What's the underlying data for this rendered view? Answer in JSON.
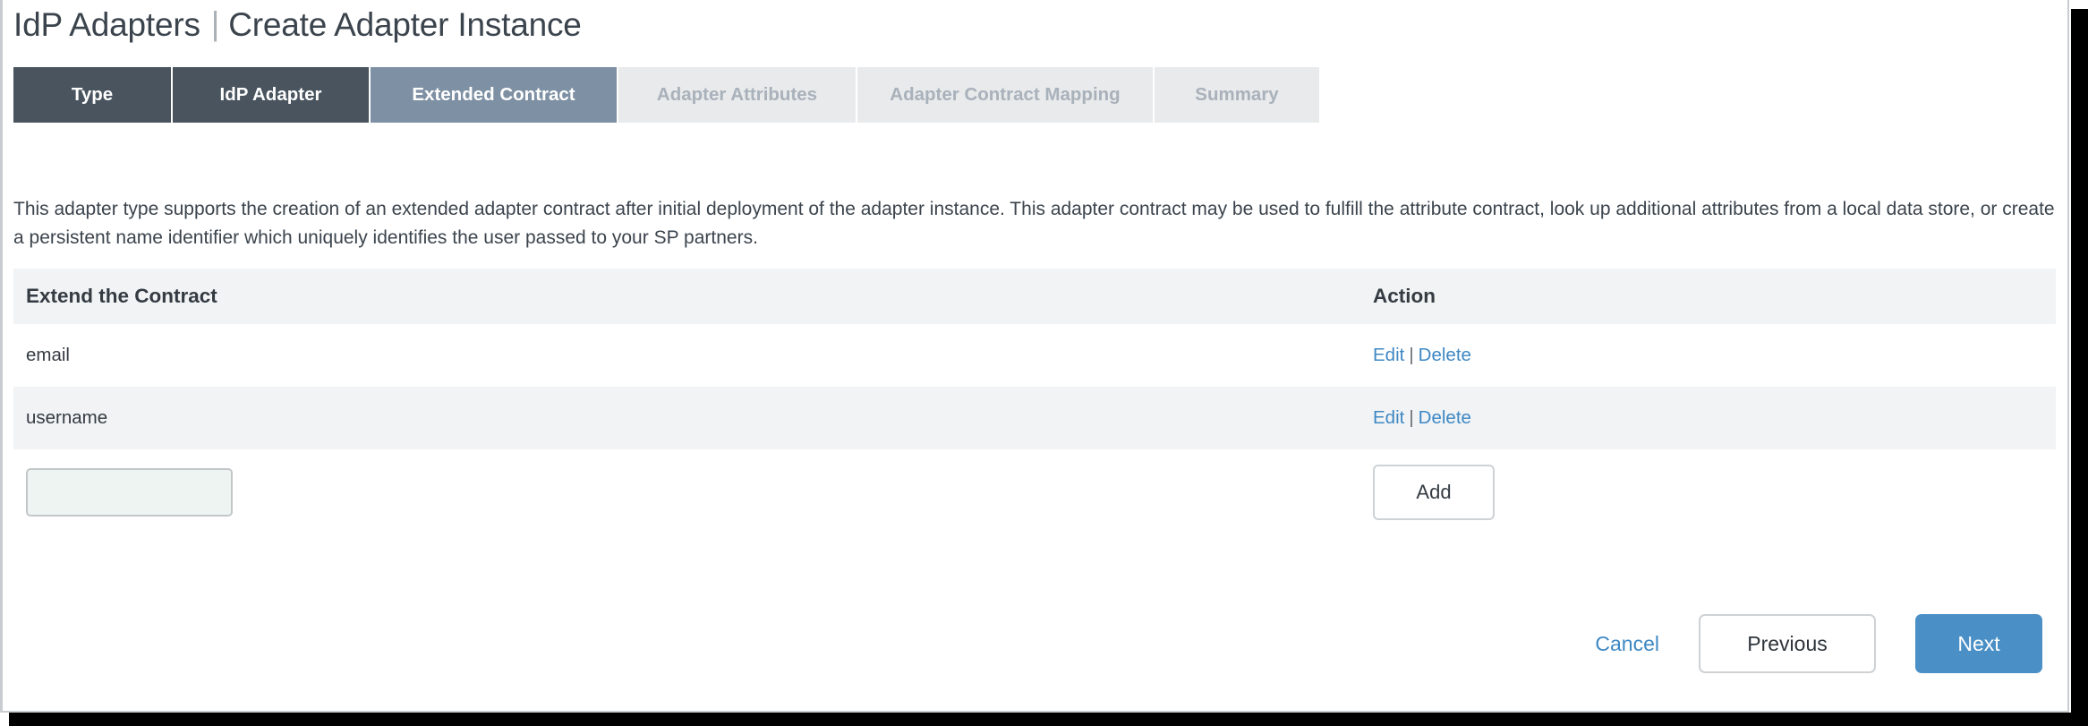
{
  "window": {
    "accent_blue": "#4a90c6",
    "link_blue": "#3e88c4",
    "tab_done_color": "#49545e",
    "tab_current_color": "#7e90a3",
    "tab_upcoming_color": "#e8eaec"
  },
  "header": {
    "section_title": "IdP Adapters",
    "divider": "|",
    "page_title": "Create Adapter Instance"
  },
  "wizard": {
    "tabs": [
      {
        "label": "Type",
        "state": "done"
      },
      {
        "label": "IdP Adapter",
        "state": "done"
      },
      {
        "label": "Extended Contract",
        "state": "current"
      },
      {
        "label": "Adapter Attributes",
        "state": "upcoming"
      },
      {
        "label": "Adapter Contract Mapping",
        "state": "upcoming"
      },
      {
        "label": "Summary",
        "state": "upcoming"
      }
    ]
  },
  "main": {
    "description": "This adapter type supports the creation of an extended adapter contract after initial deployment of the adapter instance. This adapter contract may be used to fulfill the attribute contract, look up additional attributes from a local data store, or create a persistent name identifier which uniquely identifies the user passed to your SP partners.",
    "table": {
      "columns": [
        {
          "label": "Extend the Contract"
        },
        {
          "label": "Action"
        }
      ],
      "rows": [
        {
          "name": "email",
          "edit_label": "Edit",
          "separator": "|",
          "delete_label": "Delete"
        },
        {
          "name": "username",
          "edit_label": "Edit",
          "separator": "|",
          "delete_label": "Delete"
        }
      ],
      "new_row": {
        "input_value": "",
        "input_placeholder": "",
        "add_label": "Add"
      }
    }
  },
  "footer": {
    "cancel_label": "Cancel",
    "previous_label": "Previous",
    "next_label": "Next"
  }
}
